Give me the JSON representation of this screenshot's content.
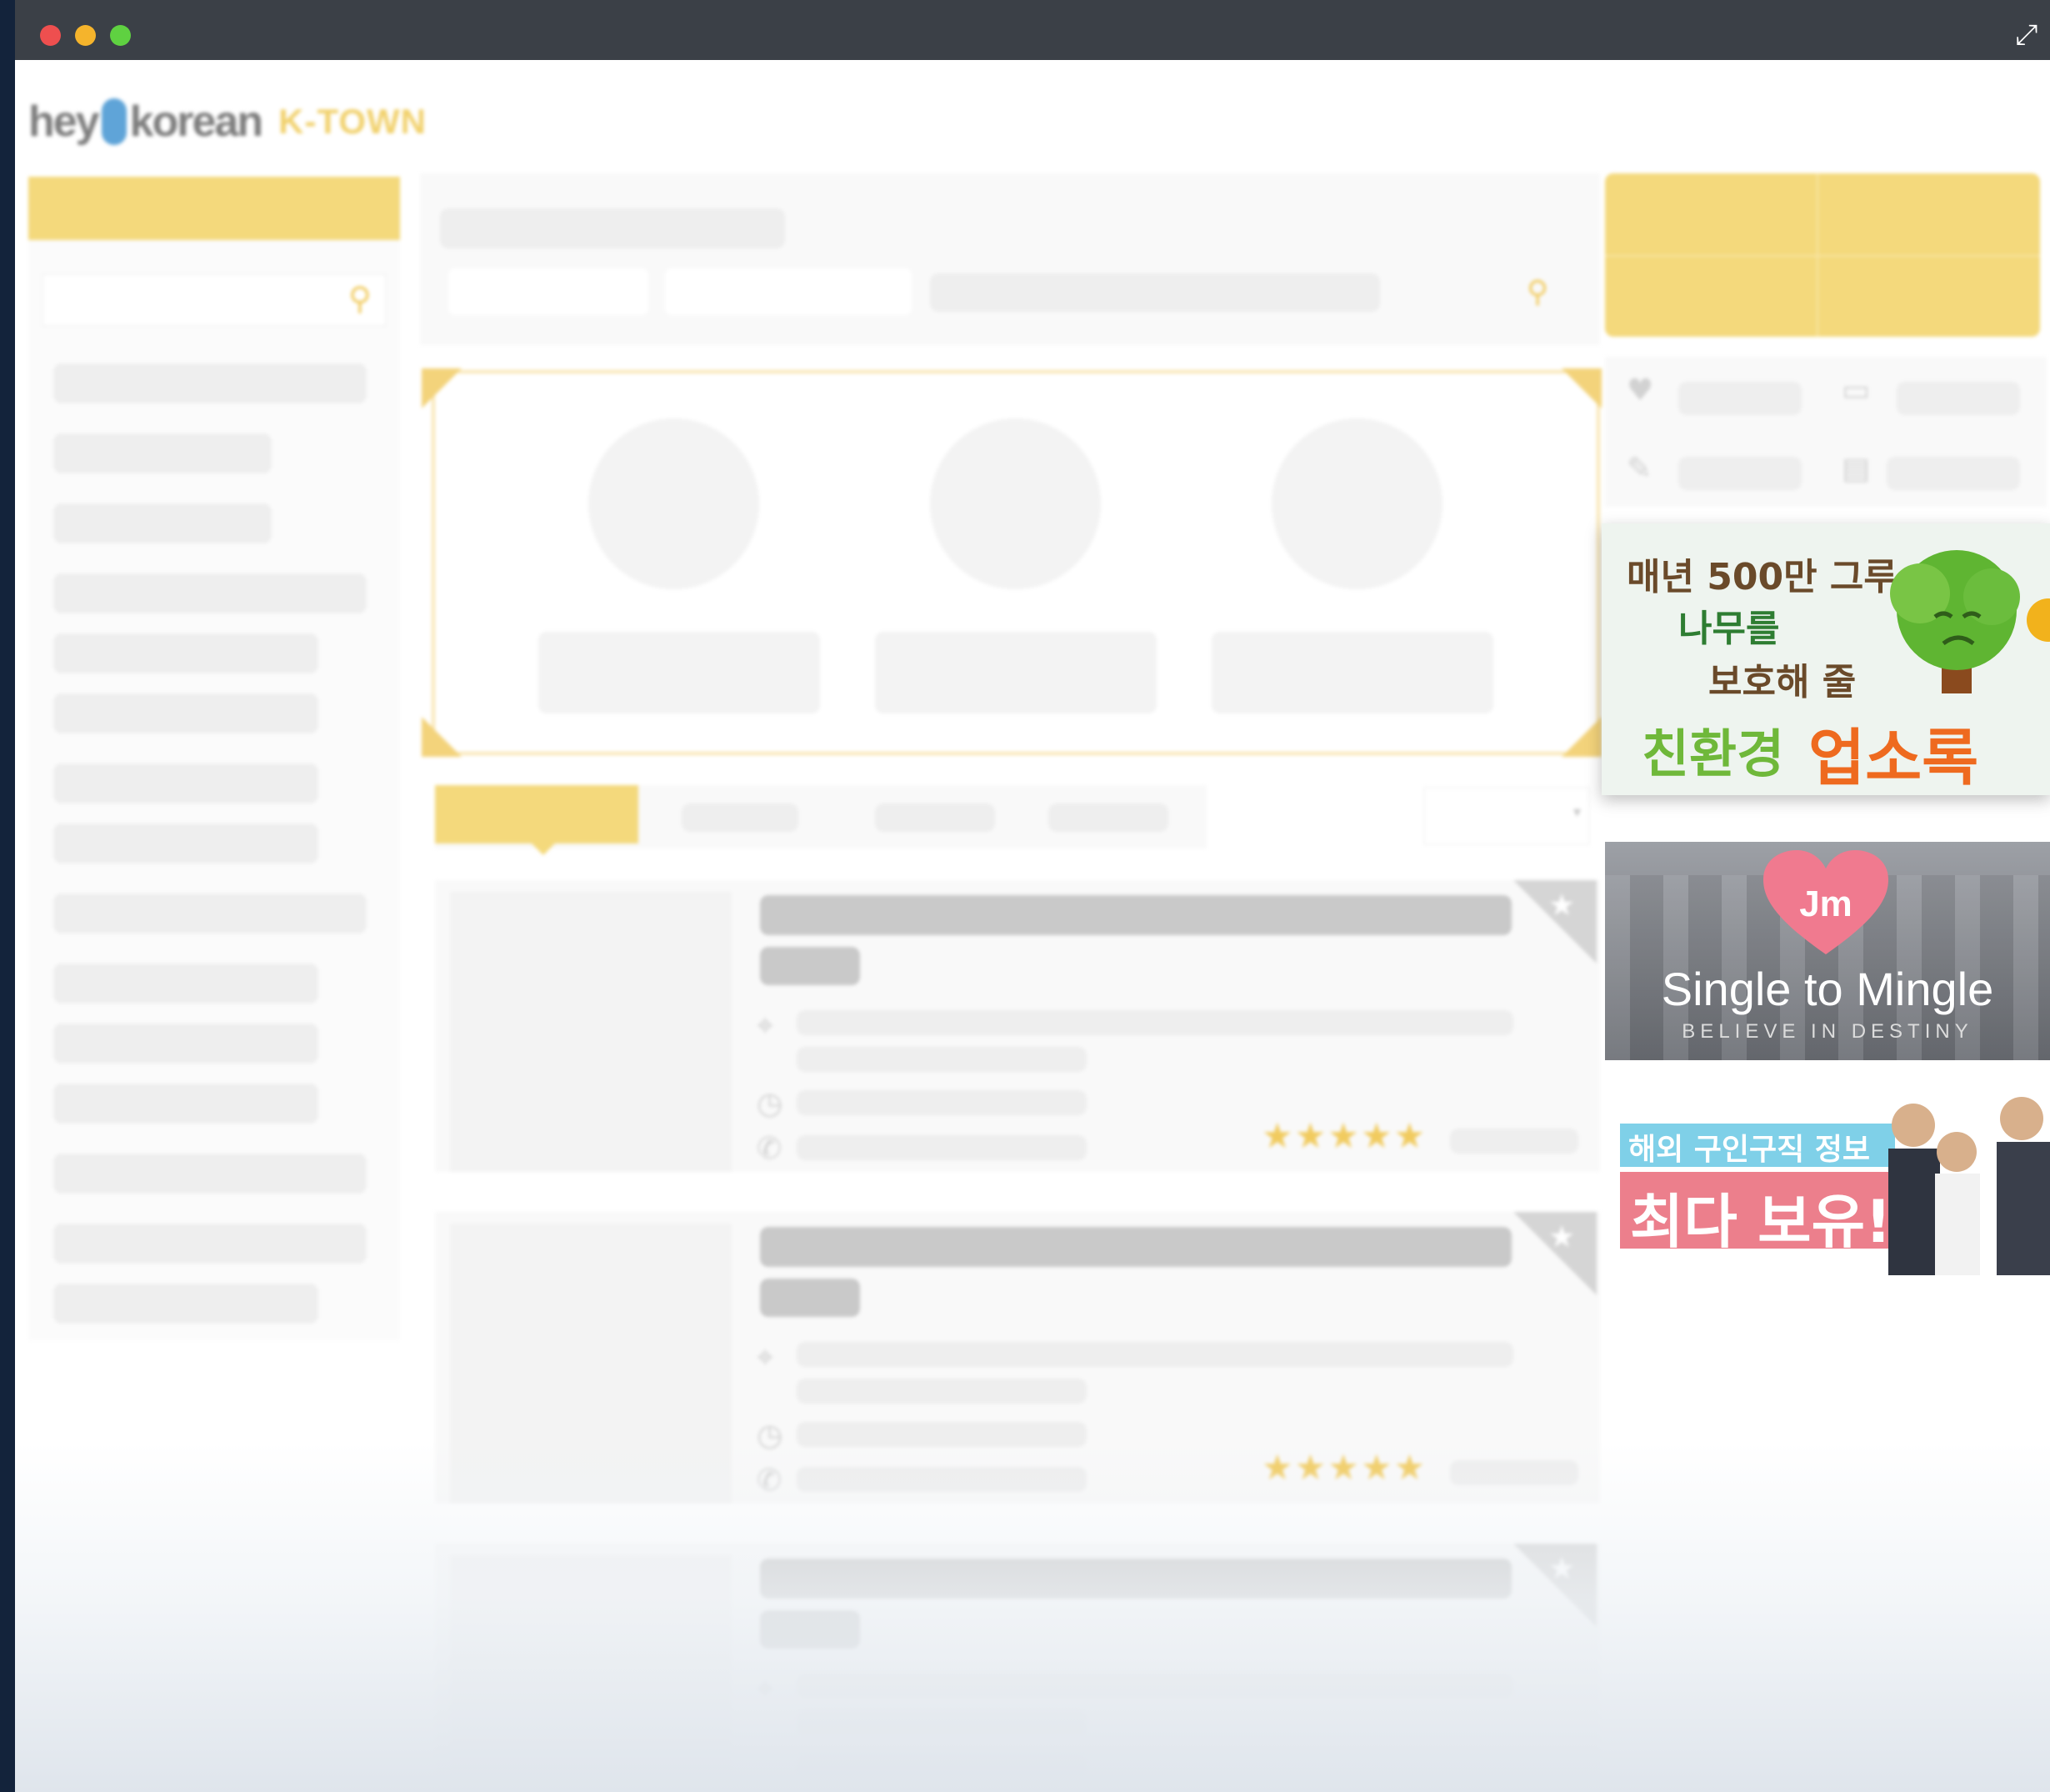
{
  "window": {
    "traffic_lights": [
      "#ee4f4f",
      "#f5b42c",
      "#5fd141"
    ],
    "expand_icon": "expand-arrows-icon"
  },
  "header": {
    "logo_hey": "hey",
    "logo_korean": "korean",
    "logo_ktown": "K-TOWN"
  },
  "listings": [
    {
      "rating_stars": "★★★★★"
    },
    {
      "rating_stars": "★★★★★"
    },
    {
      "rating_stars": ""
    }
  ],
  "ads": {
    "eco": {
      "line1": "매년 500만 그루",
      "line2": "나무를",
      "line3": "보호해 줄",
      "green_word": "친환경",
      "orange_word": "업소록"
    },
    "mingle": {
      "badge": "Jm",
      "title": "Single to Mingle",
      "tagline": "BELIEVE IN DESTINY"
    },
    "jobs": {
      "top": "해외 구인구직 정보",
      "bottom": "최다 보유!"
    }
  },
  "colors": {
    "accent_yellow": "#f4d97c",
    "star_yellow": "#f1cb5f"
  }
}
